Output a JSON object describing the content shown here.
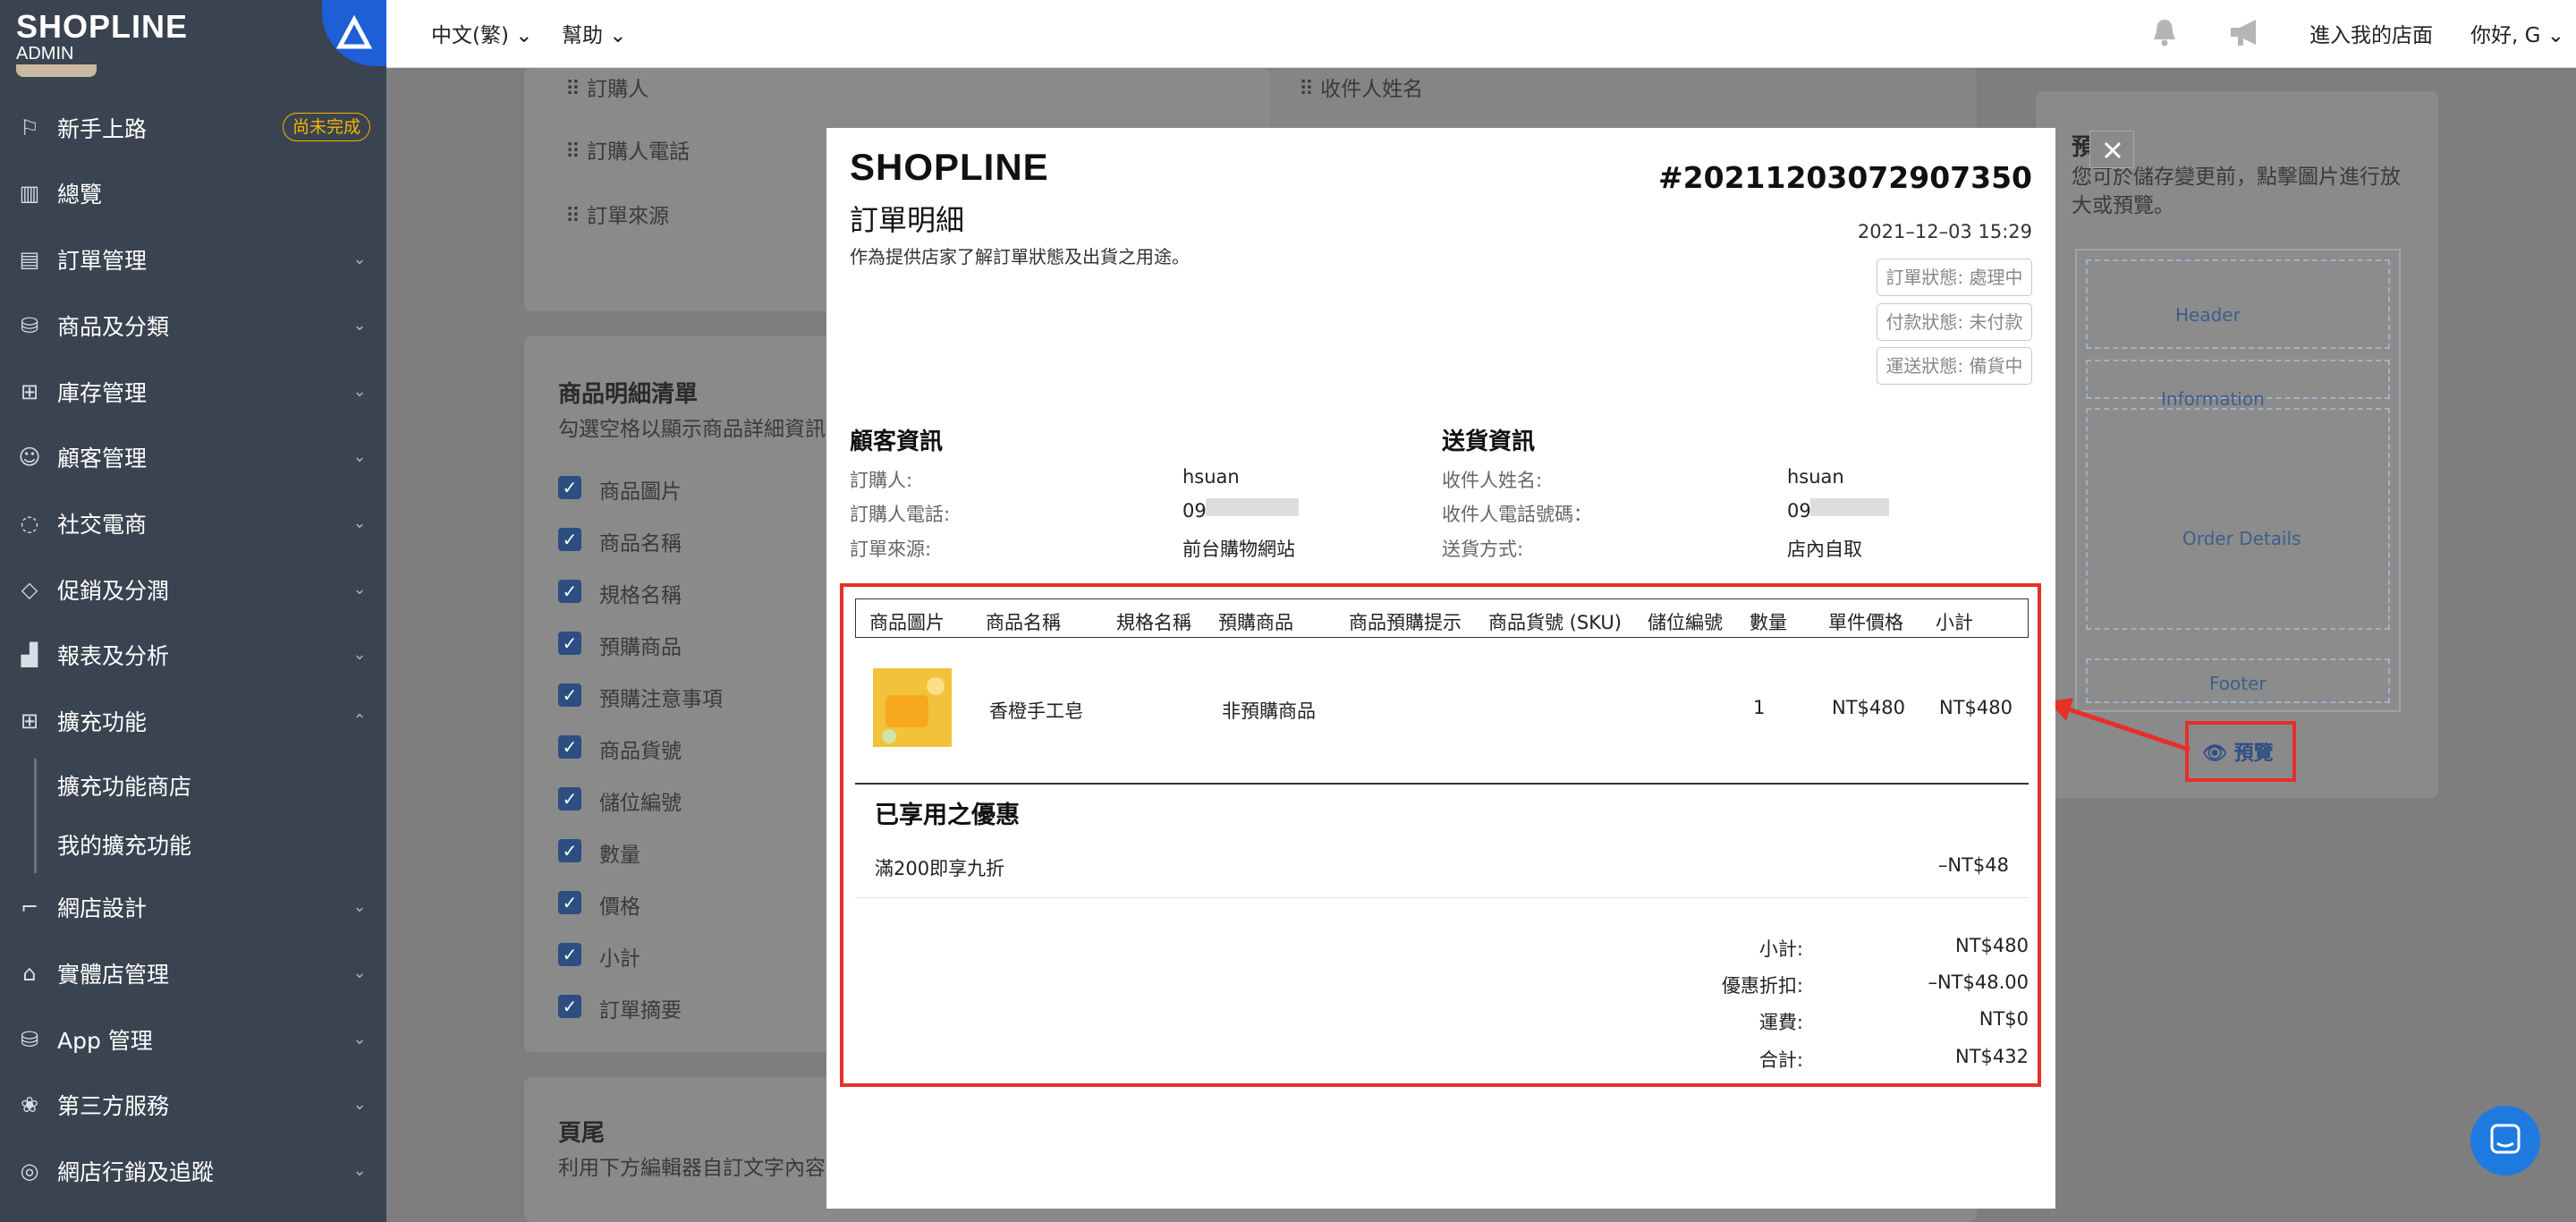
{
  "brand": {
    "name": "SHOPLINE",
    "sub": "ADMIN"
  },
  "topbar": {
    "language": "中文(繁)",
    "help": "幫助",
    "enter_store": "進入我的店面",
    "greeting": "你好, G"
  },
  "sidebar": {
    "items": [
      {
        "label": "新手上路",
        "icon": "signpost-icon",
        "badge": "尚未完成"
      },
      {
        "label": "總覽",
        "icon": "dashboard-icon"
      },
      {
        "label": "訂單管理",
        "icon": "clipboard-icon"
      },
      {
        "label": "商品及分類",
        "icon": "shopping-bag-icon"
      },
      {
        "label": "庫存管理",
        "icon": "boxes-icon"
      },
      {
        "label": "顧客管理",
        "icon": "user-icon"
      },
      {
        "label": "社交電商",
        "icon": "chat-bubble-icon"
      },
      {
        "label": "促銷及分潤",
        "icon": "tag-icon"
      },
      {
        "label": "報表及分析",
        "icon": "bar-chart-icon"
      },
      {
        "label": "擴充功能",
        "icon": "apps-plus-icon"
      },
      {
        "label": "網店設計",
        "icon": "paint-roller-icon"
      },
      {
        "label": "實體店管理",
        "icon": "storefront-icon"
      },
      {
        "label": "App 管理",
        "icon": "app-bag-icon"
      },
      {
        "label": "第三方服務",
        "icon": "third-party-icon"
      },
      {
        "label": "網店行銷及追蹤",
        "icon": "target-icon"
      }
    ],
    "sub_items": [
      "擴充功能商店",
      "我的擴充功能"
    ]
  },
  "background": {
    "fields_left": [
      "訂購人",
      "訂購人電話",
      "訂單來源"
    ],
    "fields_right": [
      "收件人姓名"
    ],
    "product_section_title": "商品明細清單",
    "product_section_desc": "勾選空格以顯示商品詳細資訊",
    "checkboxes": [
      "商品圖片",
      "商品名稱",
      "規格名稱",
      "預購商品",
      "預購注意事項",
      "商品貨號",
      "儲位編號",
      "數量",
      "價格",
      "小計",
      "訂單摘要"
    ],
    "footer_title": "頁尾",
    "footer_desc": "利用下方編輯器自訂文字內容",
    "preview_title": "預覽",
    "preview_desc": "您可於儲存變更前，點擊圖片進行放大或預覽。",
    "thumb_labels": {
      "header": "Header",
      "information": "Information",
      "order_details": "Order Details",
      "footer": "Footer"
    },
    "preview_button": "預覽"
  },
  "modal": {
    "logo": "SHOPLINE",
    "order_no": "#20211203072907350",
    "title": "訂單明細",
    "subtitle": "作為提供店家了解訂單狀態及出貨之用途。",
    "datetime": "2021–12–03 15:29",
    "statuses": [
      "訂單狀態: 處理中",
      "付款狀態: 未付款",
      "運送狀態: 備貨中"
    ],
    "customer": {
      "title": "顧客資訊",
      "rows": [
        {
          "label": "訂購人:",
          "value": "hsuan"
        },
        {
          "label": "訂購人電話:",
          "value": "09"
        },
        {
          "label": "訂單來源:",
          "value": "前台購物網站"
        }
      ]
    },
    "shipping": {
      "title": "送貨資訊",
      "rows": [
        {
          "label": "收件人姓名:",
          "value": "hsuan"
        },
        {
          "label": "收件人電話號碼：",
          "value": "09"
        },
        {
          "label": "送貨方式:",
          "value": "店內自取"
        }
      ]
    },
    "table": {
      "headers": [
        "商品圖片",
        "商品名稱",
        "規格名稱",
        "預購商品",
        "商品預購提示",
        "商品貨號 (SKU)",
        "儲位編號",
        "數量",
        "單件價格",
        "小計"
      ],
      "row": {
        "name": "香橙手工皂",
        "preorder": "非預購商品",
        "qty": "1",
        "unit_price": "NT$480",
        "subtotal": "NT$480"
      }
    },
    "discounts": {
      "title": "已享用之優惠",
      "item": "滿200即享九折",
      "amount": "–NT$48"
    },
    "totals": [
      {
        "label": "小計:",
        "value": "NT$480"
      },
      {
        "label": "優惠折扣:",
        "value": "–NT$48.00"
      },
      {
        "label": "運費:",
        "value": "NT$0"
      },
      {
        "label": "合計:",
        "value": "NT$432"
      }
    ]
  },
  "colors": {
    "sidebar": "#3a4350",
    "accent": "#1e5fd6",
    "highlight": "#e5302a",
    "badge": "#f5b400"
  }
}
